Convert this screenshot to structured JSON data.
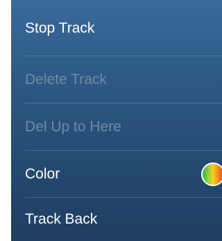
{
  "menu": {
    "items": [
      {
        "label": "Stop Track",
        "enabled": true
      },
      {
        "label": "Delete Track",
        "enabled": false
      },
      {
        "label": "Del Up to Here",
        "enabled": false
      },
      {
        "label": "Color",
        "enabled": true,
        "swatch_colors": [
          "#2db84a",
          "#9fd13a",
          "#f5d020",
          "#f39a1d",
          "#e8452a"
        ]
      },
      {
        "label": "Track Back",
        "enabled": true
      }
    ],
    "colors": {
      "background_top": "#3a6a9a",
      "background_bottom": "#1f3e60",
      "text": "#ffffff",
      "disabled_text": "#6f8aa6"
    }
  }
}
